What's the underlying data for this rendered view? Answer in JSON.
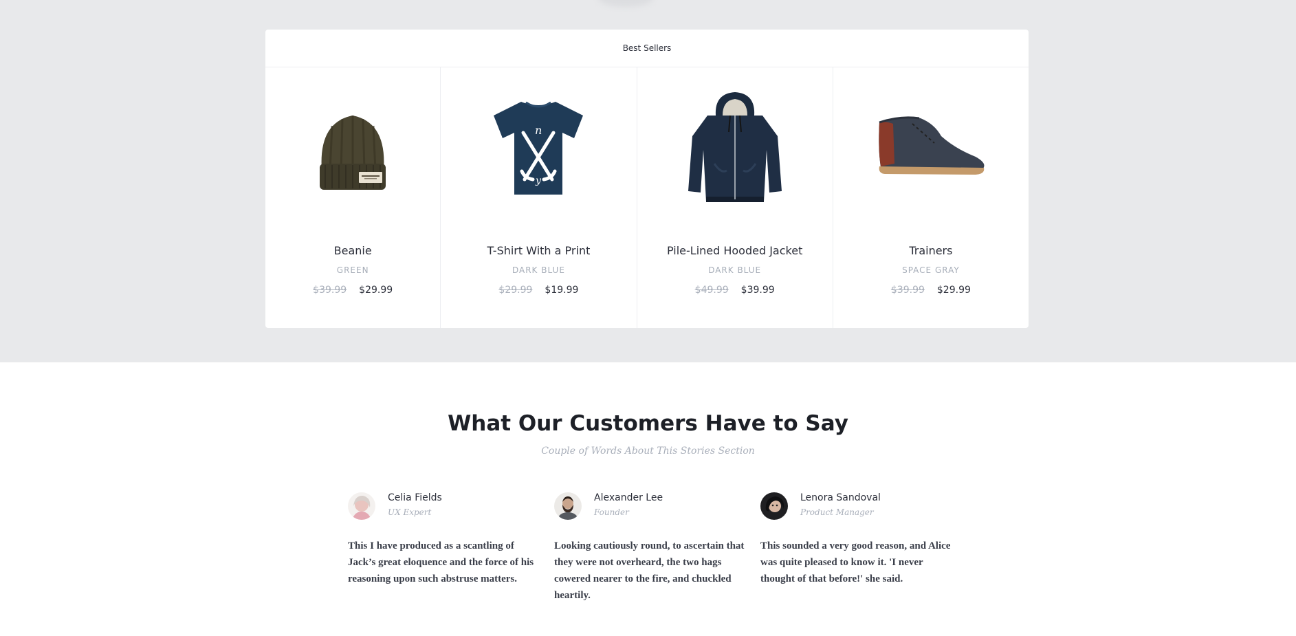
{
  "best_sellers": {
    "title": "Best Sellers",
    "products": [
      {
        "name": "Beanie",
        "color": "GREEN",
        "old_price": "$39.99",
        "price": "$29.99",
        "icon": "beanie-image"
      },
      {
        "name": "T-Shirt With a Print",
        "color": "DARK BLUE",
        "old_price": "$29.99",
        "price": "$19.99",
        "icon": "tshirt-image"
      },
      {
        "name": "Pile-Lined Hooded Jacket",
        "color": "DARK BLUE",
        "old_price": "$49.99",
        "price": "$39.99",
        "icon": "jacket-image"
      },
      {
        "name": "Trainers",
        "color": "SPACE GRAY",
        "old_price": "$39.99",
        "price": "$29.99",
        "icon": "trainers-image"
      }
    ]
  },
  "testimonials": {
    "title": "What Our Customers Have to Say",
    "subtitle": "Couple of Words About This Stories Section",
    "items": [
      {
        "name": "Celia Fields",
        "role": "UX Expert",
        "quote": "This I have produced as a scantling of Jack’s great eloquence and the force of his reasoning upon such abstruse matters."
      },
      {
        "name": "Alexander Lee",
        "role": "Founder",
        "quote": "Looking cautiously round, to ascertain that they were not overheard, the two hags cowered nearer to the fire, and chuckled heartily."
      },
      {
        "name": "Lenora Sandoval",
        "role": "Product Manager",
        "quote": "This sounded a very good reason, and Alice was quite pleased to know it. 'I never thought of that before!' she said."
      }
    ]
  },
  "colors": {
    "band_bg": "#e8e9eb",
    "text_dark": "#2c2f3a",
    "text_muted": "#a9afba"
  }
}
